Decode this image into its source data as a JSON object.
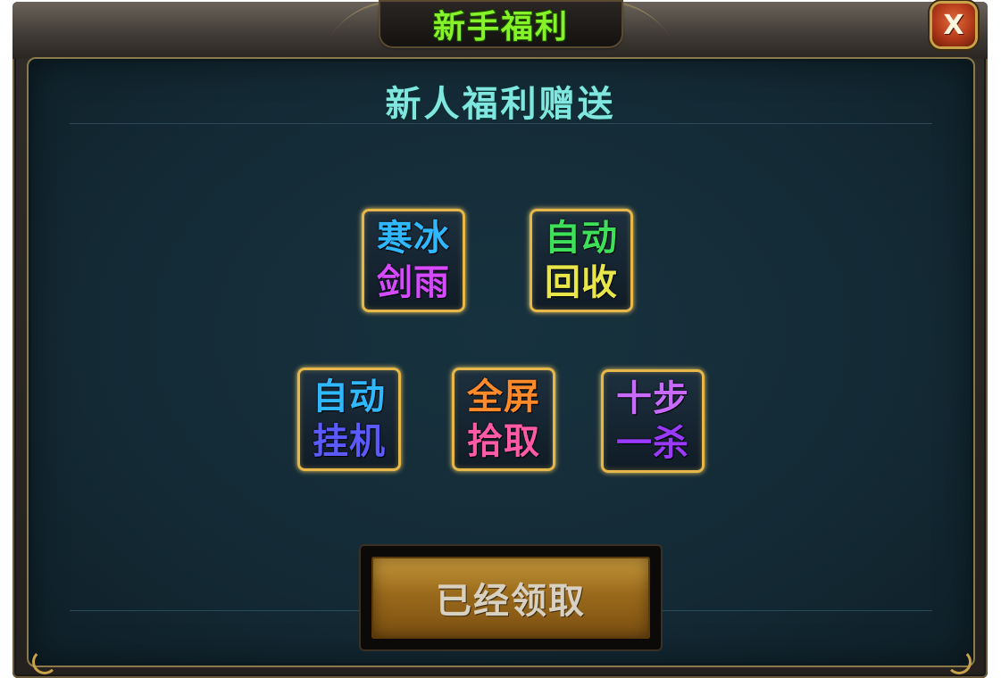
{
  "window": {
    "title": "新手福利",
    "close_label": "X"
  },
  "panel": {
    "heading": "新人福利赠送"
  },
  "rewards": [
    {
      "line1": "寒冰",
      "line2": "剑雨",
      "color1": "#2fb8ff",
      "color2": "#d64aff"
    },
    {
      "line1": "自动",
      "line2": "回收",
      "color1": "#3ee05a",
      "color2": "#e8e64a"
    },
    {
      "line1": "自动",
      "line2": "挂机",
      "color1": "#2fb8ff",
      "color2": "#5a5aff"
    },
    {
      "line1": "全屏",
      "line2": "拾取",
      "color1": "#ff8a2a",
      "color2": "#ff5aa8"
    },
    {
      "line1": "十步",
      "line2": "一杀",
      "color1": "#c86aff",
      "color2": "#9a3aff"
    }
  ],
  "claim_button": {
    "label": "已经领取"
  },
  "colors": {
    "title_text": "#86f22a",
    "heading_text": "#7fe6e0",
    "card_border": "#e6b84a",
    "panel_bg": "#142b36",
    "button_bg": "#9a6a1c"
  }
}
